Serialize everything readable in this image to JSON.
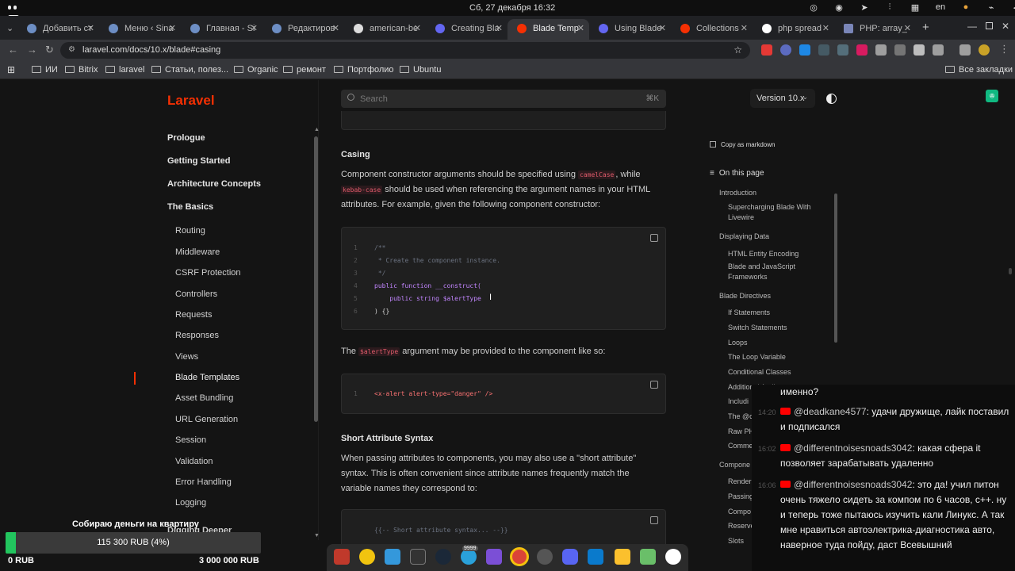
{
  "system": {
    "clock": "Сб, 27 декабря  16:32",
    "lang": "en"
  },
  "tabs": [
    {
      "label": "Добавить ст"
    },
    {
      "label": "Меню ‹ Sina"
    },
    {
      "label": "Главная - Si"
    },
    {
      "label": "Редактиров"
    },
    {
      "label": "american-be"
    },
    {
      "label": "Creating Bla"
    },
    {
      "label": "Blade Temp"
    },
    {
      "label": "Using Blade"
    },
    {
      "label": "Collections"
    },
    {
      "label": "php spread"
    },
    {
      "label": "PHP: array_"
    }
  ],
  "address": {
    "url": "laravel.com/docs/10.x/blade#casing"
  },
  "bookmarks": [
    "ИИ",
    "Bitrix",
    "laravel",
    "Статьи, полез...",
    "Organic",
    "ремонт",
    "Портфолио",
    "Ubuntu"
  ],
  "bookmarks_all": "Все закладки",
  "header": {
    "logo": "Laravel",
    "search_placeholder": "Search",
    "search_kbd": "⌘K",
    "version": "Version 10.x"
  },
  "sidebar": {
    "sections": [
      "Prologue",
      "Getting Started",
      "Architecture Concepts",
      "The Basics"
    ],
    "items": [
      "Routing",
      "Middleware",
      "CSRF Protection",
      "Controllers",
      "Requests",
      "Responses",
      "Views",
      "Blade Templates",
      "Asset Bundling",
      "URL Generation",
      "Session",
      "Validation",
      "Error Handling",
      "Logging",
      "Digging Deeper"
    ]
  },
  "content": {
    "casing_heading": "Casing",
    "p1_a": "Component constructor arguments should be specified using ",
    "p1_code1": "camelCase",
    "p1_b": ", while",
    "p1_code2": "kebab-case",
    "p1_c": " should be used when referencing the argument names in your HTML",
    "p1_d": "attributes. For example, given the following component constructor:",
    "code1": [
      "/**",
      " * Create the component instance.",
      " */",
      "public function __construct(",
      "    public string $alertType",
      ") {}"
    ],
    "p2_a": "The ",
    "p2_code": "$alertType",
    "p2_b": " argument may be provided to the component like so:",
    "code2": [
      "<x-alert alert-type=\"danger\" />"
    ],
    "short_heading": "Short Attribute Syntax",
    "p3_1": "When passing attributes to components, you may also use a \"short attribute\"",
    "p3_2": "syntax. This is often convenient since attribute names frequently match the",
    "p3_3": "variable names they correspond to:",
    "code3": [
      "{{-- Short attribute syntax... --}}"
    ]
  },
  "toc": {
    "copy_md": "Copy as markdown",
    "on_this_page": "On this page",
    "entries": [
      "Introduction",
      "Supercharging Blade With",
      "Livewire",
      "Displaying Data",
      "HTML Entity Encoding",
      "Blade and JavaScript",
      "Frameworks",
      "Blade Directives",
      "If Statements",
      "Switch Statements",
      "Loops",
      "The Loop Variable",
      "Conditional Classes",
      "Additional Attributes",
      "Includi",
      "The @c",
      "Raw PH",
      "Comme",
      "Compone",
      "Render",
      "Passing",
      "Compo",
      "Reserve",
      "Slots"
    ]
  },
  "chat": {
    "top": "именно?",
    "messages": [
      {
        "time": "14:20",
        "name": "@deadkane4577",
        "text": "удачи дружище, лайк поставил и подписался"
      },
      {
        "time": "16:02",
        "name": "@differentnoisesnoads3042",
        "text": "какая сфера it позволяет зарабатывать удаленно"
      },
      {
        "time": "16:06",
        "name": "@differentnoisesnoads3042",
        "text": "это да! учил питон очень тяжело сидеть за компом по 6 часов, с++. ну и теперь тоже пытаюсь изучить кали Линукс. А так мне нравиться автоэлектрика-диагностика авто, наверное туда пойду, даст Всевышний"
      }
    ]
  },
  "donation": {
    "title": "Собираю деньги на квартиру",
    "current": "115 300 RUB (4%)",
    "progress": 0.04,
    "min": "0 RUB",
    "max": "3 000 000 RUB"
  },
  "dock_badge": "9999"
}
